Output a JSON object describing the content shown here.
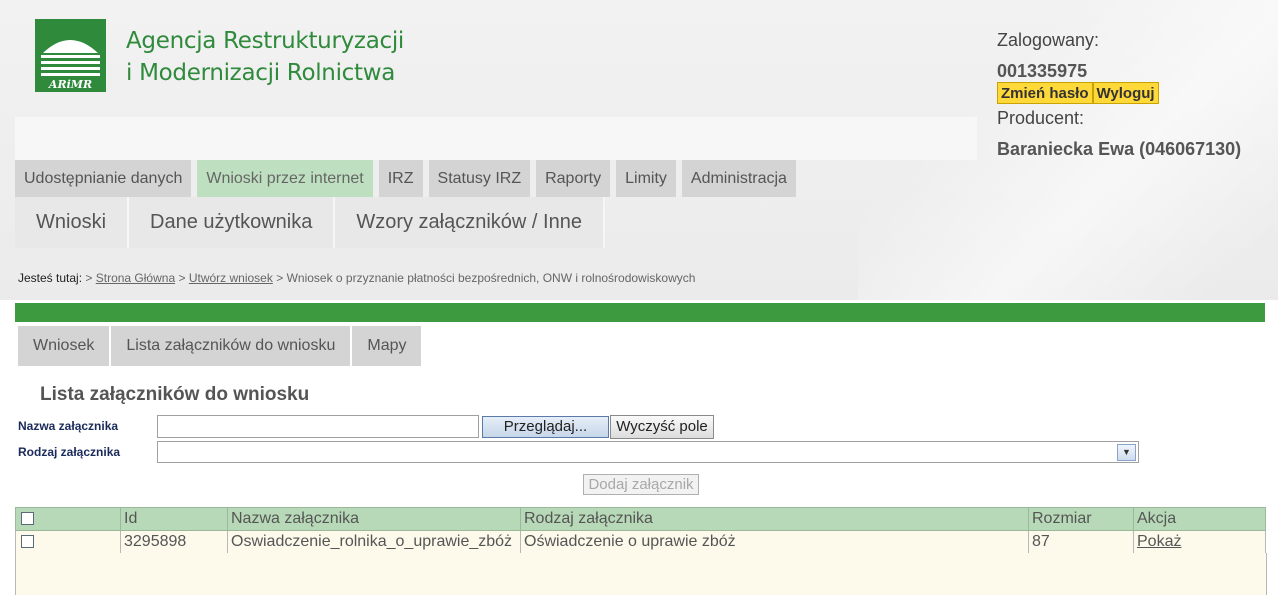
{
  "org": {
    "line1": "Agencja Restrukturyzacji",
    "line2": "i Modernizacji Rolnictwa",
    "logo_text": "ARiMR",
    "logo_color": "#2f8a3c"
  },
  "user": {
    "logged_label": "Zalogowany:",
    "login_id": "001335975",
    "change_password": "Zmień hasło",
    "logout": "Wyloguj",
    "producer_label": "Producent:",
    "producer_name": "Baraniecka Ewa (046067130)"
  },
  "nav_main": [
    {
      "label": "Udostępnianie danych"
    },
    {
      "label": "Wnioski przez internet",
      "active": true
    },
    {
      "label": "IRZ"
    },
    {
      "label": "Statusy IRZ"
    },
    {
      "label": "Raporty"
    },
    {
      "label": "Limity"
    },
    {
      "label": "Administracja"
    }
  ],
  "nav_sub": [
    {
      "label": "Wnioski"
    },
    {
      "label": "Dane użytkownika"
    },
    {
      "label": "Wzory załączników / Inne"
    }
  ],
  "breadcrumb": {
    "prefix": "Jesteś tutaj:",
    "sep": ">",
    "link1": "Strona Główna",
    "link2": "Utwórz wniosek",
    "current": "Wniosek o przyznanie płatności bezpośrednich, ONW i rolnośrodowiskowych"
  },
  "subtabs": [
    {
      "label": "Wniosek"
    },
    {
      "label": "Lista załączników do wniosku"
    },
    {
      "label": "Mapy"
    }
  ],
  "form": {
    "title": "Lista załączników do wniosku",
    "name_label": "Nazwa załącznika",
    "type_label": "Rodzaj załącznika",
    "browse": "Przeglądaj...",
    "clear": "Wyczyść pole",
    "add": "Dodaj załącznik",
    "name_value": "",
    "type_value": ""
  },
  "table": {
    "headers": [
      "",
      "Id",
      "Nazwa załącznika",
      "Rodzaj załącznika",
      "Rozmiar",
      "Akcja"
    ],
    "rows": [
      {
        "id": "3295898",
        "name": "Oswiadczenie_rolnika_o_uprawie_zbóż",
        "type": "Oświadczenie o uprawie zbóż",
        "size": "87",
        "action": "Pokaż"
      }
    ]
  }
}
